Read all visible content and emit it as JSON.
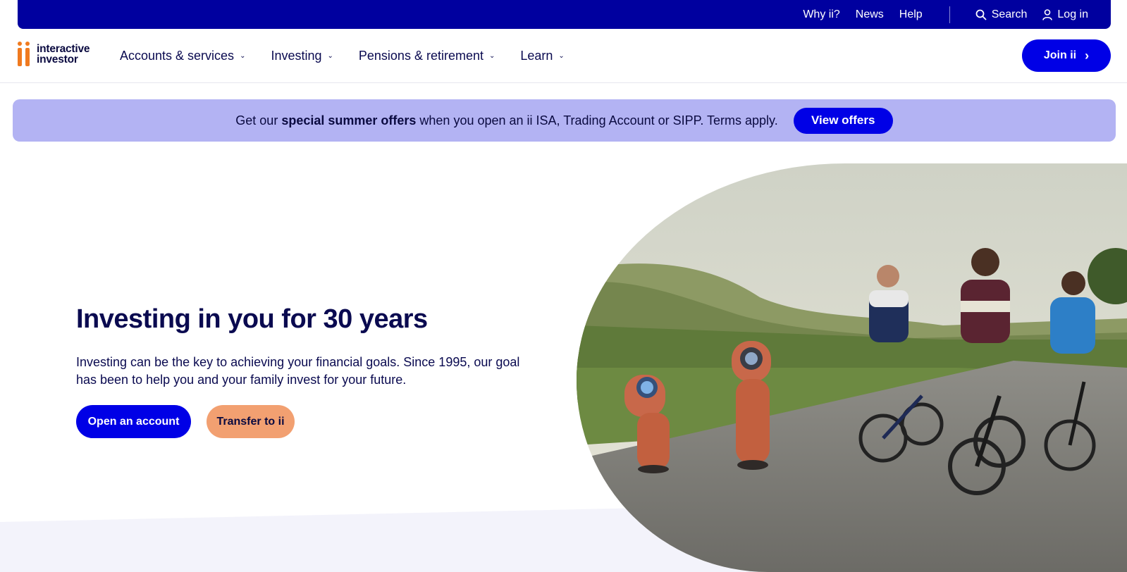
{
  "util_bar": {
    "links": [
      "Why ii?",
      "News",
      "Help"
    ],
    "search_label": "Search",
    "login_label": "Log in"
  },
  "brand": {
    "logo_line1": "interactive",
    "logo_line2": "investor",
    "logo_icon": "ii-logo-icon",
    "accent": "#f07a1f",
    "primary": "#0000e6",
    "navy": "#00009f"
  },
  "nav": {
    "items": [
      {
        "label": "Accounts & services"
      },
      {
        "label": "Investing"
      },
      {
        "label": "Pensions & retirement"
      },
      {
        "label": "Learn"
      }
    ],
    "join_label": "Join ii"
  },
  "promo": {
    "text_before": "Get our ",
    "text_bold": "special summer offers",
    "text_after": " when you open an ii ISA, Trading Account or SIPP. Terms apply.",
    "button_label": "View offers",
    "bg_color": "#b3b3f3"
  },
  "hero": {
    "title": "Investing in you for 30 years",
    "text": "Investing can be the key to achieving your financial goals. Since 1995, our goal has been to help you and your family invest for your future.",
    "open_label": "Open an account",
    "transfer_label": "Transfer to ii"
  }
}
